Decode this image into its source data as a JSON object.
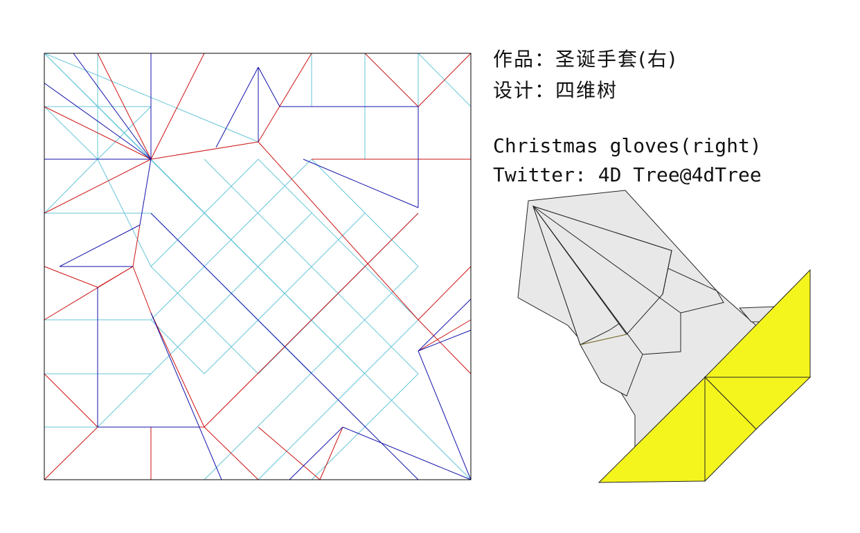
{
  "info": {
    "work_line": "作品：圣诞手套(右)",
    "designer_line": "设计：四维树",
    "title_en": "Christmas gloves(right)",
    "twitter_line": "Twitter: 4D Tree@4dTree"
  },
  "colors": {
    "mountain": "#cc1111",
    "valley": "#1111aa",
    "aux": "#66c6d8",
    "border": "#000000",
    "paper_back": "#e8e8e8",
    "paper_front": "#f5f51e"
  }
}
